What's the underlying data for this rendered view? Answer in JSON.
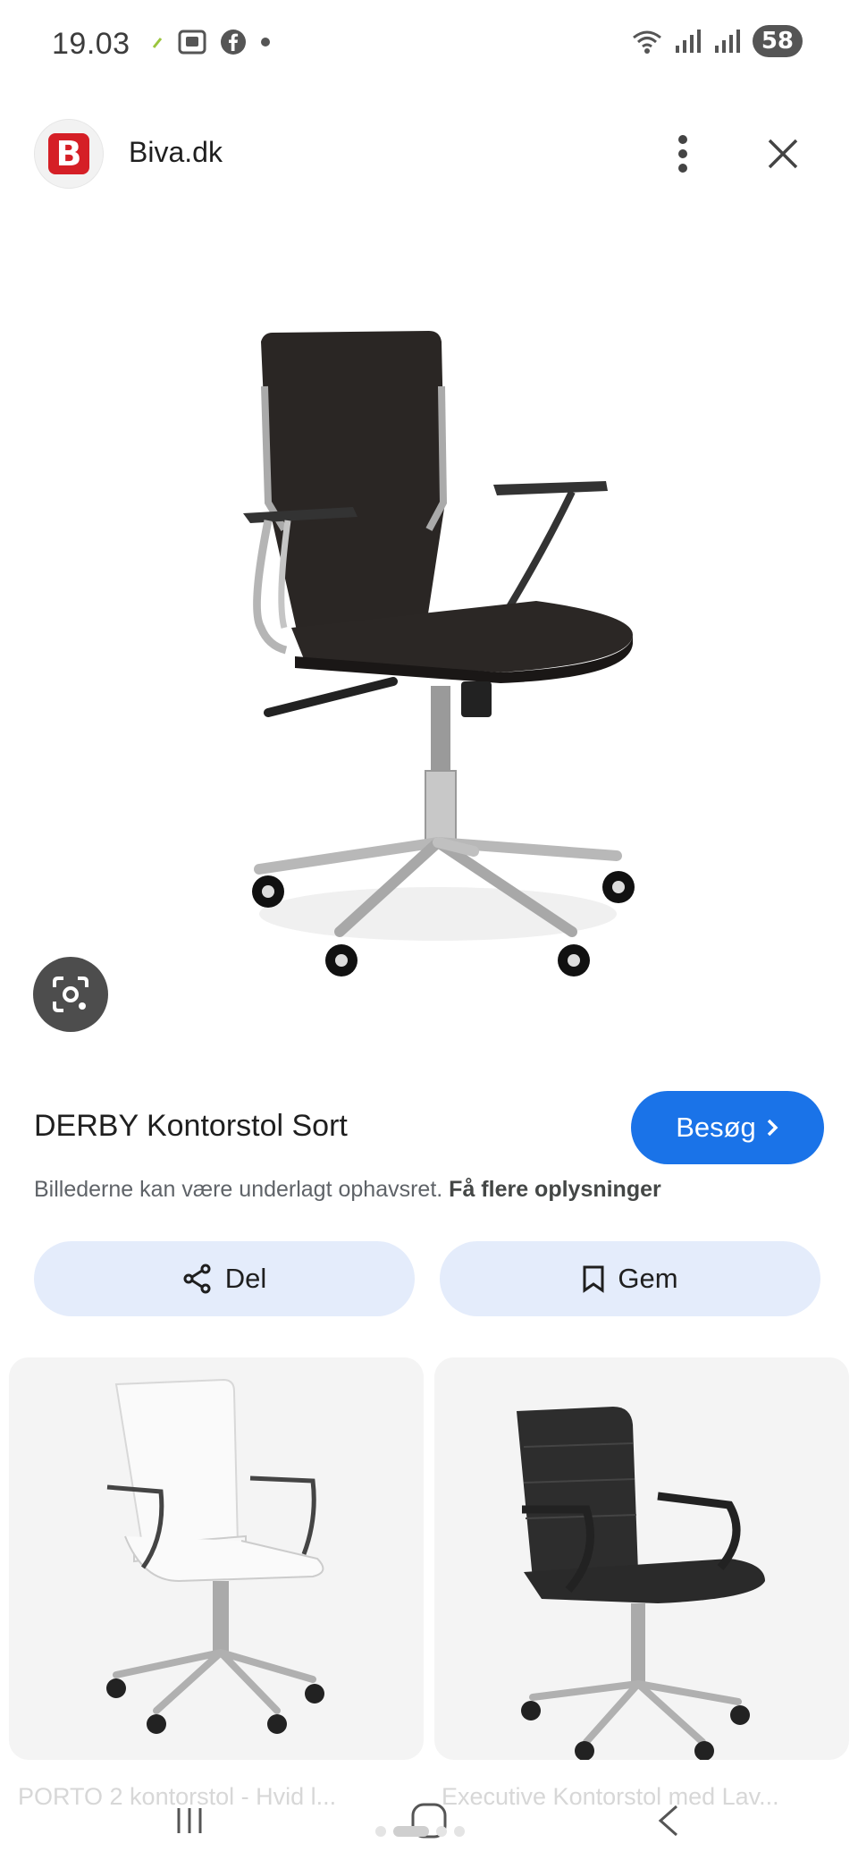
{
  "status_bar": {
    "time": "19.03",
    "battery": "58"
  },
  "header": {
    "site_logo_letter": "B",
    "site_name": "Biva.dk"
  },
  "product": {
    "title": "DERBY Kontorstol Sort",
    "visit_label": "Besøg",
    "notice_text": "Billederne kan være underlagt ophavsret.",
    "notice_link": "Få flere oplysninger"
  },
  "actions": {
    "share_label": "Del",
    "save_label": "Gem"
  },
  "related": [
    {
      "label": "PORTO 2 kontorstol - Hvid l..."
    },
    {
      "label": "Executive Kontorstol med Lav..."
    }
  ],
  "colors": {
    "accent": "#1a73e8",
    "action_bg": "#e4ecfb",
    "brand": "#d51f26"
  },
  "icons": {
    "status": [
      "check-icon",
      "screenshot-icon",
      "facebook-icon",
      "dot-icon",
      "wifi-icon",
      "signal-icon",
      "signal-icon"
    ],
    "header": [
      "more-vert-icon",
      "close-icon"
    ],
    "lens": "google-lens-icon",
    "nav": [
      "recents-icon",
      "home-icon",
      "back-icon"
    ]
  }
}
